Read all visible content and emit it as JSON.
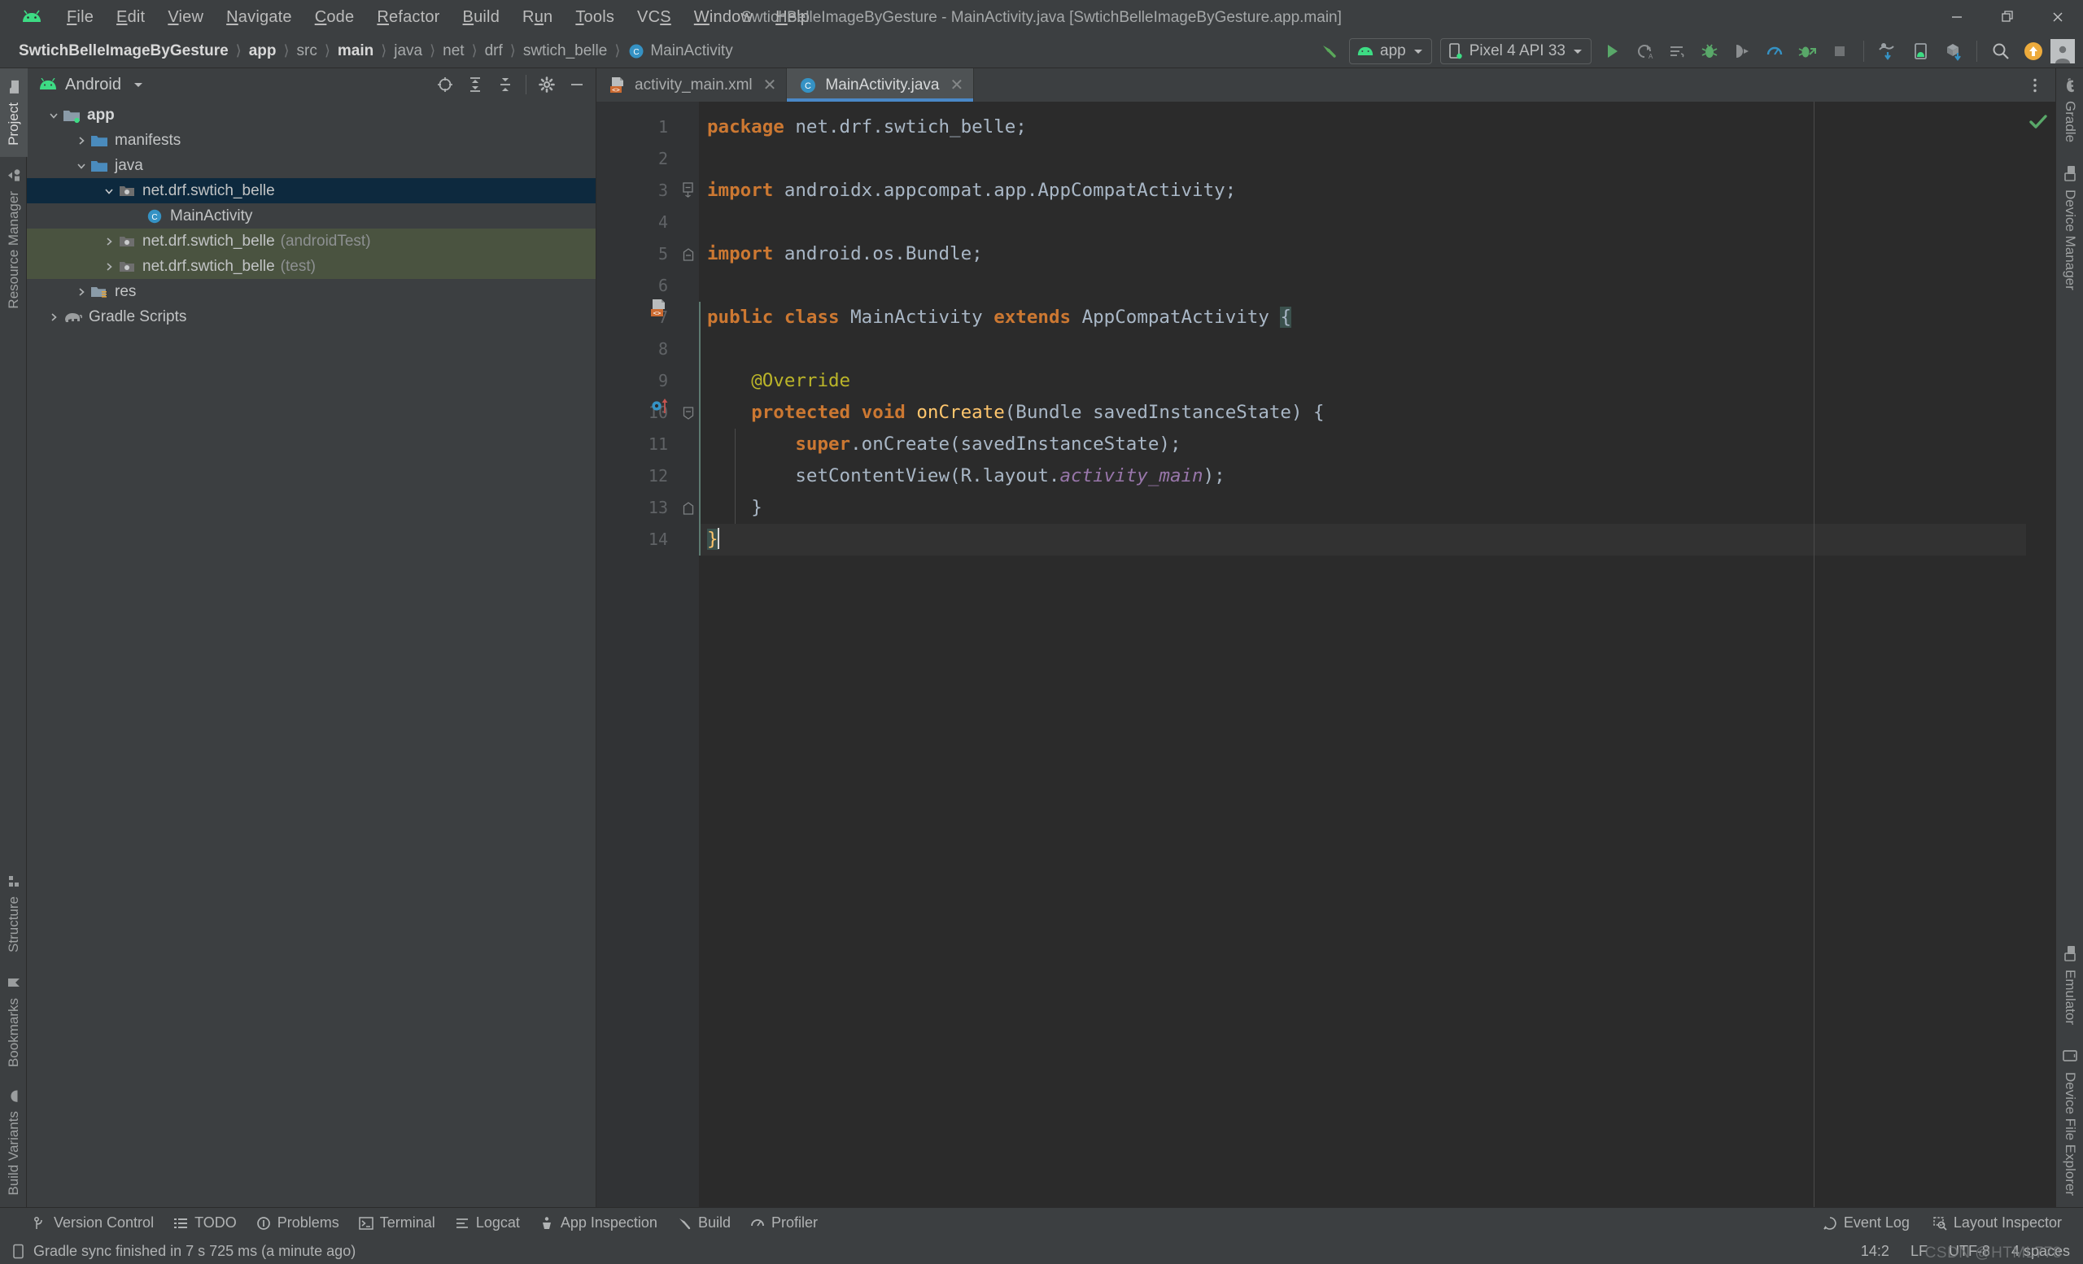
{
  "window": {
    "title": "SwtichBelleImageByGesture - MainActivity.java [SwtichBelleImageByGesture.app.main]",
    "minimize_label": "—",
    "restore_label": "❐",
    "close_label": "✕"
  },
  "menu": {
    "items": [
      {
        "label": "File",
        "mnemonic": "F"
      },
      {
        "label": "Edit",
        "mnemonic": "E"
      },
      {
        "label": "View",
        "mnemonic": "V"
      },
      {
        "label": "Navigate",
        "mnemonic": "N"
      },
      {
        "label": "Code",
        "mnemonic": "C"
      },
      {
        "label": "Refactor",
        "mnemonic": "R"
      },
      {
        "label": "Build",
        "mnemonic": "B"
      },
      {
        "label": "Run",
        "mnemonic": "u"
      },
      {
        "label": "Tools",
        "mnemonic": "T"
      },
      {
        "label": "VCS",
        "mnemonic": "S"
      },
      {
        "label": "Window",
        "mnemonic": "W"
      },
      {
        "label": "Help",
        "mnemonic": "H"
      }
    ]
  },
  "breadcrumbs": [
    {
      "label": "SwtichBelleImageByGesture",
      "bold": true
    },
    {
      "label": "app",
      "bold": true
    },
    {
      "label": "src",
      "bold": false
    },
    {
      "label": "main",
      "bold": true
    },
    {
      "label": "java",
      "bold": false
    },
    {
      "label": "net",
      "bold": false
    },
    {
      "label": "drf",
      "bold": false
    },
    {
      "label": "swtich_belle",
      "bold": false
    },
    {
      "label": "MainActivity",
      "bold": false,
      "icon": "class-icon"
    }
  ],
  "toolbar": {
    "build_hammer": "build-icon",
    "run_config": "app",
    "device": "Pixel 4 API 33",
    "actions": [
      "run-icon",
      "apply-changes-icon",
      "apply-code-changes-icon",
      "debug-icon",
      "attach-debugger-icon",
      "profiler-icon",
      "run-with-coverage-icon",
      "stop-icon"
    ],
    "sync_actions": [
      "sync-gradle-icon",
      "avd-manager-icon",
      "sdk-manager-icon"
    ],
    "search_icon": "search-icon",
    "update_icon": "update-available-icon",
    "avatar": "avatar"
  },
  "project_panel": {
    "title": "Android",
    "dropdown_icon": "chevron-down-icon",
    "actions": [
      "select-opened-file-icon",
      "expand-all-icon",
      "collapse-all-icon",
      "settings-gear-icon",
      "hide-icon"
    ],
    "tree": [
      {
        "label": "app",
        "indent": 0,
        "arrow": "down",
        "icon": "module-folder-icon",
        "bold": true,
        "state": "normal"
      },
      {
        "label": "manifests",
        "indent": 1,
        "arrow": "right",
        "icon": "folder-icon",
        "bold": false,
        "state": "normal"
      },
      {
        "label": "java",
        "indent": 1,
        "arrow": "down",
        "icon": "folder-icon",
        "bold": false,
        "state": "normal"
      },
      {
        "label": "net.drf.swtich_belle",
        "indent": 2,
        "arrow": "down",
        "icon": "package-icon",
        "bold": false,
        "state": "selected"
      },
      {
        "label": "MainActivity",
        "indent": 3,
        "arrow": "none",
        "icon": "class-icon",
        "bold": false,
        "state": "normal"
      },
      {
        "label": "net.drf.swtich_belle",
        "suffix": "(androidTest)",
        "indent": 2,
        "arrow": "right",
        "icon": "package-icon",
        "bold": false,
        "state": "testsrc"
      },
      {
        "label": "net.drf.swtich_belle",
        "suffix": "(test)",
        "indent": 2,
        "arrow": "right",
        "icon": "package-icon",
        "bold": false,
        "state": "testsrc"
      },
      {
        "label": "res",
        "indent": 1,
        "arrow": "right",
        "icon": "res-folder-icon",
        "bold": false,
        "state": "normal"
      },
      {
        "label": "Gradle Scripts",
        "indent": 0,
        "arrow": "right",
        "icon": "gradle-icon",
        "bold": false,
        "state": "normal"
      }
    ]
  },
  "editor": {
    "tabs": [
      {
        "label": "activity_main.xml",
        "icon": "xml-layout-icon",
        "active": false
      },
      {
        "label": "MainActivity.java",
        "icon": "class-icon",
        "active": true
      }
    ],
    "more_icon": "more-vertical-icon",
    "inspection_status": "ok-check-icon",
    "line_numbers": [
      "1",
      "2",
      "3",
      "4",
      "5",
      "6",
      "7",
      "8",
      "9",
      "10",
      "11",
      "12",
      "13",
      "14"
    ],
    "code": [
      "package net.drf.swtich_belle;",
      "",
      "import androidx.appcompat.app.AppCompatActivity;",
      "",
      "import android.os.Bundle;",
      "",
      "public class MainActivity extends AppCompatActivity {",
      "",
      "    @Override",
      "    protected void onCreate(Bundle savedInstanceState) {",
      "        super.onCreate(savedInstanceState);",
      "        setContentView(R.layout.activity_main);",
      "    }",
      "}"
    ],
    "current_line": 14
  },
  "left_strip": {
    "top": [
      {
        "label": "Project",
        "icon": "project-folder-icon",
        "active": true
      },
      {
        "label": "Resource Manager",
        "icon": "resource-manager-icon",
        "active": false
      }
    ],
    "bottom": [
      {
        "label": "Structure",
        "icon": "structure-icon",
        "active": false
      },
      {
        "label": "Bookmarks",
        "icon": "bookmark-icon",
        "active": false
      },
      {
        "label": "Build Variants",
        "icon": "android-variant-icon",
        "active": false
      }
    ]
  },
  "right_strip": {
    "top": [
      {
        "label": "Gradle",
        "icon": "gradle-elephant-icon",
        "active": false
      },
      {
        "label": "Device Manager",
        "icon": "device-manager-icon",
        "active": false
      }
    ],
    "bottom": [
      {
        "label": "Emulator",
        "icon": "emulator-icon",
        "active": false
      },
      {
        "label": "Device File Explorer",
        "icon": "device-file-explorer-icon",
        "active": false
      }
    ]
  },
  "bottom_bar": {
    "items": [
      {
        "label": "Version Control",
        "icon": "branch-icon"
      },
      {
        "label": "TODO",
        "icon": "todo-list-icon"
      },
      {
        "label": "Problems",
        "icon": "problems-icon"
      },
      {
        "label": "Terminal",
        "icon": "terminal-icon"
      },
      {
        "label": "Logcat",
        "icon": "logcat-icon"
      },
      {
        "label": "App Inspection",
        "icon": "app-inspection-icon"
      },
      {
        "label": "Build",
        "icon": "build-hammer-icon"
      },
      {
        "label": "Profiler",
        "icon": "profiler-icon"
      }
    ],
    "right_items": [
      {
        "label": "Event Log",
        "icon": "event-log-icon"
      },
      {
        "label": "Layout Inspector",
        "icon": "layout-inspector-icon"
      }
    ]
  },
  "status_bar": {
    "message": "Gradle sync finished in 7 s 725 ms (a minute ago)",
    "message_icon": "device-icon",
    "caret": "14:2",
    "line_separator": "LF",
    "encoding": "UTF-8",
    "indent": "4 spaces",
    "watermark": "CSDN @HTML778"
  },
  "colors": {
    "chrome": "#3c3f41",
    "editor_bg": "#2b2b2b",
    "gutter_bg": "#313335",
    "selection": "#0d293e",
    "test_source": "#4a5340",
    "accent_blue": "#4a88c7",
    "android_green": "#3ddc84",
    "keyword_orange": "#cc7832",
    "method_yellow": "#ffc66d",
    "annotation": "#bbb529",
    "field_purple": "#9876aa",
    "text": "#a9b7c6"
  }
}
